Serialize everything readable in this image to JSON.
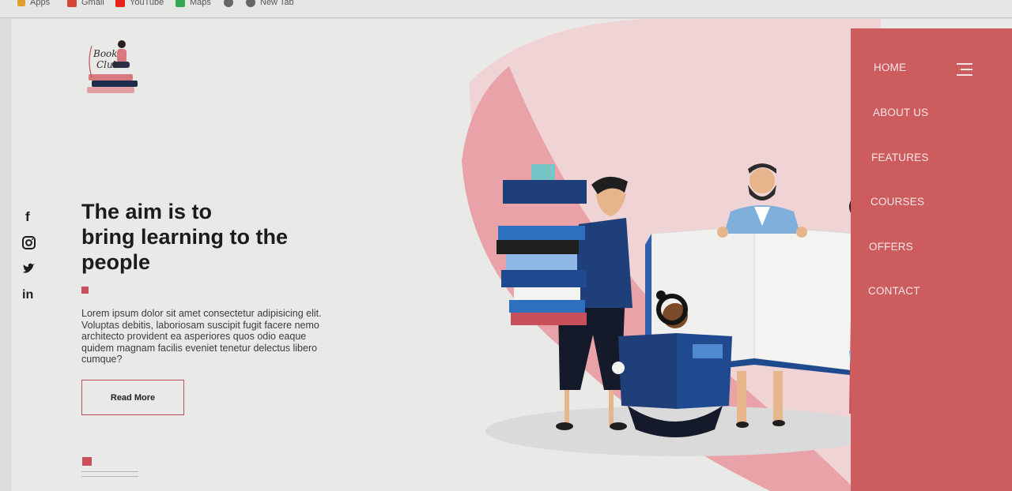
{
  "bookmarks": [
    {
      "label": "Apps",
      "icon": "apps-grid-icon",
      "color": "#e0a030"
    },
    {
      "label": "Gmail",
      "icon": "gmail-icon",
      "color": "#d44638"
    },
    {
      "label": "YouTube",
      "icon": "youtube-icon",
      "color": "#e62117"
    },
    {
      "label": "Maps",
      "icon": "maps-icon",
      "color": "#34a853"
    },
    {
      "label": "",
      "icon": "globe-icon",
      "color": "#666666"
    },
    {
      "label": "New Tab",
      "icon": "globe-icon",
      "color": "#666666"
    }
  ],
  "social": [
    {
      "label": "f",
      "icon": "facebook-icon"
    },
    {
      "label": "◎",
      "icon": "instagram-icon"
    },
    {
      "label": "🐦",
      "icon": "twitter-icon"
    },
    {
      "label": "in",
      "icon": "linkedin-icon"
    }
  ],
  "hero": {
    "headline_line1": "The aim is to",
    "headline_line2": "bring learning to the",
    "headline_line3": "people",
    "body": "Lorem ipsum dolor sit amet consectetur adipisicing elit. Voluptas debitis, laboriosam suscipit fugit facere nemo architecto provident ea asperiores quos odio eaque quidem magnam facilis eveniet tenetur delectus libero cumque?",
    "cta": "Read More"
  },
  "nav": {
    "items": [
      "HOME",
      "ABOUT US",
      "FEATURES",
      "COURSES",
      "OFFERS",
      "CONTACT"
    ],
    "menu_icon": "hamburger-menu-icon"
  },
  "logo": {
    "text_line1": "Book",
    "text_line2": "Club"
  },
  "colors": {
    "accent": "#cd5c5f",
    "navy": "#1f3f7a",
    "pink_light": "#f0c7c9",
    "text_dark": "#1b1b1b"
  }
}
